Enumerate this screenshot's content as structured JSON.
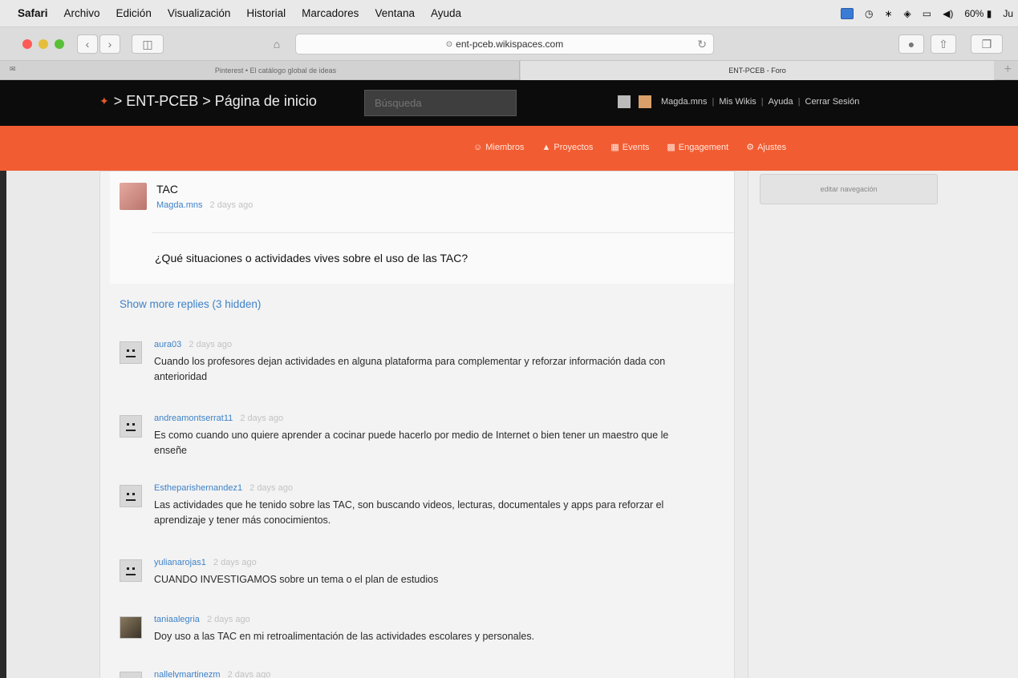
{
  "menubar": {
    "app": "Safari",
    "items": [
      "Archivo",
      "Edición",
      "Visualización",
      "Historial",
      "Marcadores",
      "Ventana",
      "Ayuda"
    ],
    "battery": "60%",
    "clock": "Ju"
  },
  "browser": {
    "url": "ent-pceb.wikispaces.com",
    "tabs": [
      {
        "title": "Pinterest • El catálogo global de ideas"
      },
      {
        "title": "ENT-PCEB - Foro"
      }
    ]
  },
  "wiki": {
    "breadcrumb": "> ENT-PCEB > Página de inicio",
    "search_placeholder": "Búsqueda",
    "user": "Magda.mns",
    "links": [
      "Mis Wikis",
      "Ayuda",
      "Cerrar Sesión"
    ],
    "nav": [
      {
        "icon": "members-icon",
        "label": "Miembros"
      },
      {
        "icon": "projects-icon",
        "label": "Proyectos"
      },
      {
        "icon": "events-icon",
        "label": "Events"
      },
      {
        "icon": "engagement-icon",
        "label": "Engagement"
      },
      {
        "icon": "settings-icon",
        "label": "Ajustes"
      }
    ]
  },
  "sidebar": {
    "edit_nav": "editar navegación"
  },
  "post": {
    "title": "TAC",
    "author": "Magda.mns",
    "time": "2 days ago",
    "body": "¿Qué situaciones o actividades vives sobre el uso de las TAC?"
  },
  "show_more": "Show more replies (3 hidden)",
  "replies": [
    {
      "author": "aura03",
      "time": "2 days ago",
      "text": "Cuando los profesores dejan actividades en alguna plataforma para complementar y reforzar información dada con anterioridad"
    },
    {
      "author": "andreamontserrat11",
      "time": "2 days ago",
      "text": "Es como cuando uno quiere aprender a cocinar puede hacerlo por medio de Internet o bien tener un maestro que le enseñe"
    },
    {
      "author": "Estheparishernandez1",
      "time": "2 days ago",
      "text": "Las actividades que he tenido sobre las TAC, son buscando videos, lecturas, documentales y apps para reforzar el aprendizaje y tener más conocimientos."
    },
    {
      "author": "yulianarojas1",
      "time": "2 days ago",
      "text": "CUANDO INVESTIGAMOS sobre un tema o el plan de estudios"
    },
    {
      "author": "taniaalegria",
      "time": "2 days ago",
      "text": "Doy uso a las TAC en mi retroalimentación de las actividades escolares y personales."
    },
    {
      "author": "nallelymartinezm",
      "time": "2 days ago",
      "text": ""
    }
  ]
}
